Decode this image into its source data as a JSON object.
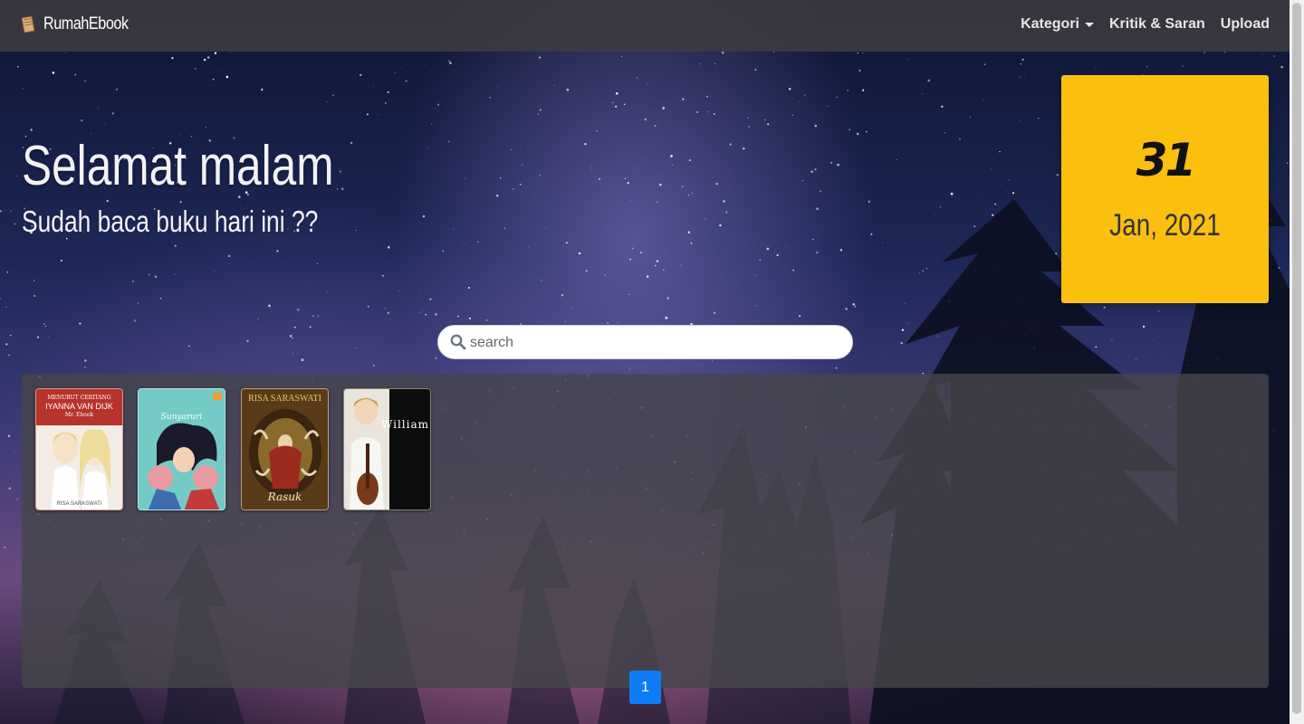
{
  "navbar": {
    "brand": "RumahEbook",
    "links": [
      {
        "label": "Kategori",
        "dropdown": true
      },
      {
        "label": "Kritik & Saran"
      },
      {
        "label": "Upload"
      }
    ]
  },
  "hero": {
    "greeting": "Selamat malam",
    "subtitle": "Sudah baca buku hari ini ??"
  },
  "date_card": {
    "day": "31",
    "month_year": "Jan, 2021",
    "color": "#fbbf0e"
  },
  "search": {
    "placeholder": "search",
    "value": ""
  },
  "books": [
    {
      "cover_lines": [
        "MENURUT CERITANG",
        "IYANNA VAN DIJK",
        "Mr. Ebook",
        "RISA SARASWATI"
      ],
      "color": "#b8332c"
    },
    {
      "cover_lines": [
        "Sunyaruri"
      ],
      "color": "#6cc4c2"
    },
    {
      "cover_lines": [
        "RISA SARASWATI",
        "Rasuk"
      ],
      "color": "#6b4a1c"
    },
    {
      "cover_lines": [
        "William"
      ],
      "color": "#111111"
    }
  ],
  "pagination": {
    "current": "1",
    "color": "#0d7cf5"
  }
}
